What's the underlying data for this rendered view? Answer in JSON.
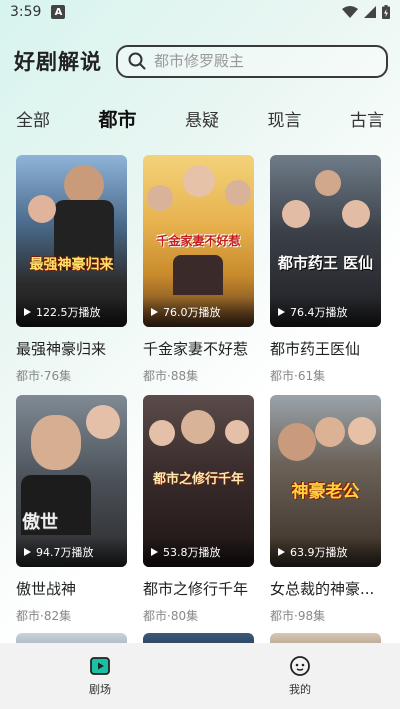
{
  "status": {
    "time": "3:59",
    "badge": "A"
  },
  "header": {
    "title": "好剧解说"
  },
  "search": {
    "placeholder": "都市修罗殿主"
  },
  "tabs": [
    {
      "label": "全部",
      "active": false
    },
    {
      "label": "都市",
      "active": true
    },
    {
      "label": "悬疑",
      "active": false
    },
    {
      "label": "现言",
      "active": false
    },
    {
      "label": "古言",
      "active": false
    }
  ],
  "cards": [
    {
      "title": "最强神豪归来",
      "meta": "都市·76集",
      "plays": "122.5万播放",
      "poster_text": "最强神豪归来"
    },
    {
      "title": "千金家妻不好惹",
      "meta": "都市·88集",
      "plays": "76.0万播放",
      "poster_text": "千金家妻不好惹"
    },
    {
      "title": "都市药王医仙",
      "meta": "都市·61集",
      "plays": "76.4万播放",
      "poster_text": "都市药王 医仙"
    },
    {
      "title": "傲世战神",
      "meta": "都市·82集",
      "plays": "94.7万播放",
      "poster_text": "傲世"
    },
    {
      "title": "都市之修行千年",
      "meta": "都市·80集",
      "plays": "53.8万播放",
      "poster_text": "都市之修行千年"
    },
    {
      "title": "女总裁的神豪...",
      "meta": "都市·98集",
      "plays": "63.9万播放",
      "poster_text": "神豪老公"
    }
  ],
  "nav": {
    "theater": "剧场",
    "mine": "我的"
  },
  "colors": {
    "accent": "#1bbfa4",
    "bg_gradient_start": "#d7f4ef"
  }
}
